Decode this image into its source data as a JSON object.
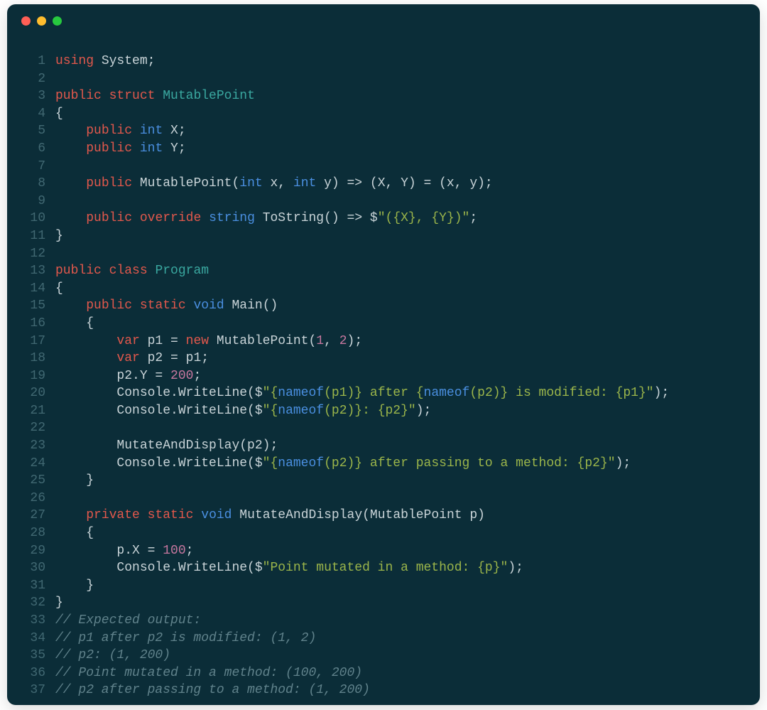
{
  "titlebar": {
    "dots": {
      "red": "#ff5f56",
      "yellow": "#ffbd2e",
      "green": "#27c93f"
    }
  },
  "theme": {
    "bg": "#0b2d38",
    "gutter": "#416872",
    "default": "#c9d4d8",
    "keyword": "#e2584c",
    "type": "#3aa8a0",
    "builtin": "#4a8fe0",
    "numeric": "#c7779f",
    "string": "#9bb54a",
    "comment": "#60828b"
  },
  "lines": [
    {
      "n": 1,
      "t": [
        [
          "kw",
          "using"
        ],
        [
          "text",
          " System;"
        ]
      ]
    },
    {
      "n": 2,
      "t": [
        [
          "text",
          ""
        ]
      ]
    },
    {
      "n": 3,
      "t": [
        [
          "kw",
          "public"
        ],
        [
          "text",
          " "
        ],
        [
          "kw",
          "struct"
        ],
        [
          "text",
          " "
        ],
        [
          "type",
          "MutablePoint"
        ]
      ]
    },
    {
      "n": 4,
      "t": [
        [
          "text",
          "{"
        ]
      ]
    },
    {
      "n": 5,
      "t": [
        [
          "text",
          "    "
        ],
        [
          "kw",
          "public"
        ],
        [
          "text",
          " "
        ],
        [
          "btype",
          "int"
        ],
        [
          "text",
          " X;"
        ]
      ]
    },
    {
      "n": 6,
      "t": [
        [
          "text",
          "    "
        ],
        [
          "kw",
          "public"
        ],
        [
          "text",
          " "
        ],
        [
          "btype",
          "int"
        ],
        [
          "text",
          " Y;"
        ]
      ]
    },
    {
      "n": 7,
      "t": [
        [
          "text",
          ""
        ]
      ]
    },
    {
      "n": 8,
      "t": [
        [
          "text",
          "    "
        ],
        [
          "kw",
          "public"
        ],
        [
          "text",
          " MutablePoint("
        ],
        [
          "btype",
          "int"
        ],
        [
          "text",
          " x, "
        ],
        [
          "btype",
          "int"
        ],
        [
          "text",
          " y) => (X, Y) = (x, y);"
        ]
      ]
    },
    {
      "n": 9,
      "t": [
        [
          "text",
          ""
        ]
      ]
    },
    {
      "n": 10,
      "t": [
        [
          "text",
          "    "
        ],
        [
          "kw",
          "public"
        ],
        [
          "text",
          " "
        ],
        [
          "kw",
          "override"
        ],
        [
          "text",
          " "
        ],
        [
          "btype",
          "string"
        ],
        [
          "text",
          " ToString() => $"
        ],
        [
          "str",
          "\"({X}, {Y})\""
        ],
        [
          "text",
          ";"
        ]
      ]
    },
    {
      "n": 11,
      "t": [
        [
          "text",
          "}"
        ]
      ]
    },
    {
      "n": 12,
      "t": [
        [
          "text",
          ""
        ]
      ]
    },
    {
      "n": 13,
      "t": [
        [
          "kw",
          "public"
        ],
        [
          "text",
          " "
        ],
        [
          "kw",
          "class"
        ],
        [
          "text",
          " "
        ],
        [
          "type",
          "Program"
        ]
      ]
    },
    {
      "n": 14,
      "t": [
        [
          "text",
          "{"
        ]
      ]
    },
    {
      "n": 15,
      "t": [
        [
          "text",
          "    "
        ],
        [
          "kw",
          "public"
        ],
        [
          "text",
          " "
        ],
        [
          "kw",
          "static"
        ],
        [
          "text",
          " "
        ],
        [
          "btype",
          "void"
        ],
        [
          "text",
          " Main()"
        ]
      ]
    },
    {
      "n": 16,
      "t": [
        [
          "text",
          "    {"
        ]
      ]
    },
    {
      "n": 17,
      "t": [
        [
          "text",
          "        "
        ],
        [
          "kw",
          "var"
        ],
        [
          "text",
          " p1 = "
        ],
        [
          "kw",
          "new"
        ],
        [
          "text",
          " MutablePoint("
        ],
        [
          "num",
          "1"
        ],
        [
          "text",
          ", "
        ],
        [
          "num",
          "2"
        ],
        [
          "text",
          ");"
        ]
      ]
    },
    {
      "n": 18,
      "t": [
        [
          "text",
          "        "
        ],
        [
          "kw",
          "var"
        ],
        [
          "text",
          " p2 = p1;"
        ]
      ]
    },
    {
      "n": 19,
      "t": [
        [
          "text",
          "        p2.Y = "
        ],
        [
          "num",
          "200"
        ],
        [
          "text",
          ";"
        ]
      ]
    },
    {
      "n": 20,
      "t": [
        [
          "text",
          "        Console.WriteLine($"
        ],
        [
          "str",
          "\""
        ],
        [
          "str",
          "{"
        ],
        [
          "nameof",
          "nameof"
        ],
        [
          "str",
          "(p1)} after {"
        ],
        [
          "nameof",
          "nameof"
        ],
        [
          "str",
          "(p2)} is modified: {p1}"
        ],
        [
          "str",
          "\""
        ],
        [
          "text",
          ");"
        ]
      ]
    },
    {
      "n": 21,
      "t": [
        [
          "text",
          "        Console.WriteLine($"
        ],
        [
          "str",
          "\""
        ],
        [
          "str",
          "{"
        ],
        [
          "nameof",
          "nameof"
        ],
        [
          "str",
          "(p2)}: {p2}"
        ],
        [
          "str",
          "\""
        ],
        [
          "text",
          ");"
        ]
      ]
    },
    {
      "n": 22,
      "t": [
        [
          "text",
          ""
        ]
      ]
    },
    {
      "n": 23,
      "t": [
        [
          "text",
          "        MutateAndDisplay(p2);"
        ]
      ]
    },
    {
      "n": 24,
      "t": [
        [
          "text",
          "        Console.WriteLine($"
        ],
        [
          "str",
          "\""
        ],
        [
          "str",
          "{"
        ],
        [
          "nameof",
          "nameof"
        ],
        [
          "str",
          "(p2)} after passing to a method: {p2}"
        ],
        [
          "str",
          "\""
        ],
        [
          "text",
          ");"
        ]
      ]
    },
    {
      "n": 25,
      "t": [
        [
          "text",
          "    }"
        ]
      ]
    },
    {
      "n": 26,
      "t": [
        [
          "text",
          ""
        ]
      ]
    },
    {
      "n": 27,
      "t": [
        [
          "text",
          "    "
        ],
        [
          "kw",
          "private"
        ],
        [
          "text",
          " "
        ],
        [
          "kw",
          "static"
        ],
        [
          "text",
          " "
        ],
        [
          "btype",
          "void"
        ],
        [
          "text",
          " MutateAndDisplay(MutablePoint p)"
        ]
      ]
    },
    {
      "n": 28,
      "t": [
        [
          "text",
          "    {"
        ]
      ]
    },
    {
      "n": 29,
      "t": [
        [
          "text",
          "        p.X = "
        ],
        [
          "num",
          "100"
        ],
        [
          "text",
          ";"
        ]
      ]
    },
    {
      "n": 30,
      "t": [
        [
          "text",
          "        Console.WriteLine($"
        ],
        [
          "str",
          "\"Point mutated in a method: {p}\""
        ],
        [
          "text",
          ");"
        ]
      ]
    },
    {
      "n": 31,
      "t": [
        [
          "text",
          "    }"
        ]
      ]
    },
    {
      "n": 32,
      "t": [
        [
          "text",
          "}"
        ]
      ]
    },
    {
      "n": 33,
      "t": [
        [
          "comment",
          "// Expected output:"
        ]
      ]
    },
    {
      "n": 34,
      "t": [
        [
          "comment",
          "// p1 after p2 is modified: (1, 2)"
        ]
      ]
    },
    {
      "n": 35,
      "t": [
        [
          "comment",
          "// p2: (1, 200)"
        ]
      ]
    },
    {
      "n": 36,
      "t": [
        [
          "comment",
          "// Point mutated in a method: (100, 200)"
        ]
      ]
    },
    {
      "n": 37,
      "t": [
        [
          "comment",
          "// p2 after passing to a method: (1, 200)"
        ]
      ]
    }
  ]
}
